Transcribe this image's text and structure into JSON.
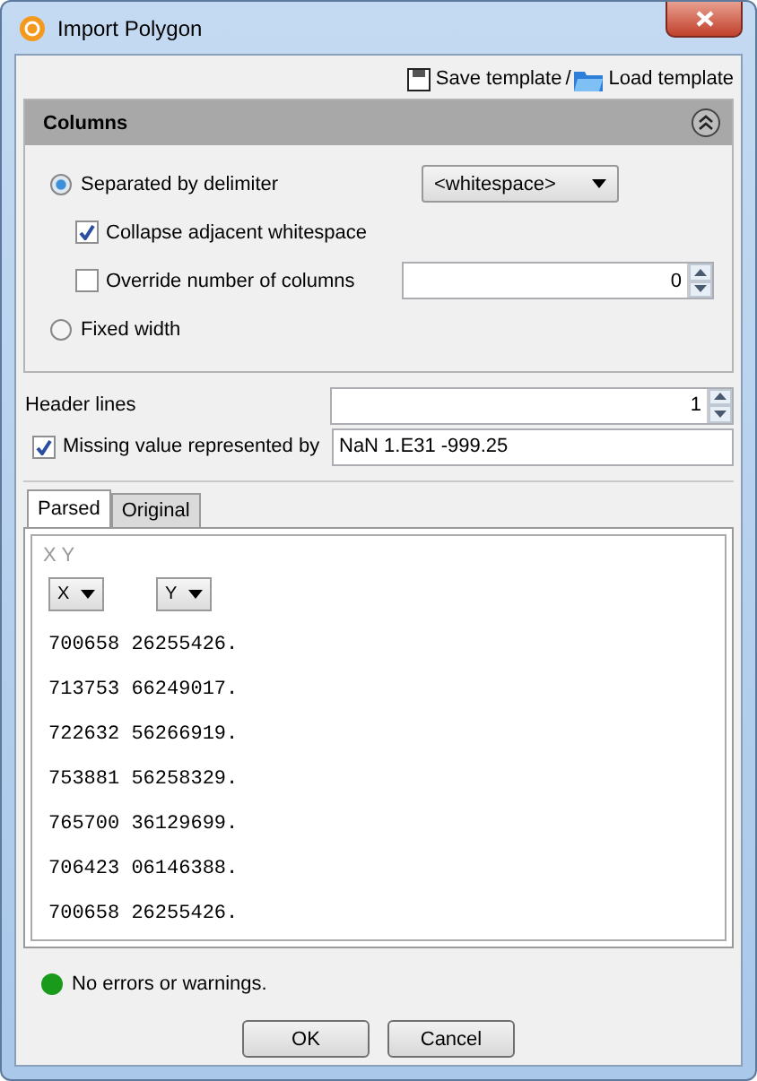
{
  "window": {
    "title": "Import Polygon"
  },
  "toolbar": {
    "save": "Save template",
    "separator": "/",
    "load": "Load template"
  },
  "columns_panel": {
    "title": "Columns",
    "expanded": true,
    "options": [
      {
        "kind": "radio",
        "label": "Separated by delimiter",
        "selected": true,
        "dropdown": "<whitespace>"
      },
      {
        "kind": "checkbox",
        "label": "Collapse adjacent whitespace",
        "checked": true
      },
      {
        "kind": "checkbox",
        "label": "Override number of columns",
        "checked": false,
        "value": "0"
      },
      {
        "kind": "radio",
        "label": "Fixed width",
        "selected": false
      }
    ]
  },
  "header_lines": {
    "label": "Header lines",
    "value": "1"
  },
  "missing_value": {
    "label": "Missing value represented by",
    "checked": true,
    "value": "NaN 1.E31 -999.25"
  },
  "tabs": [
    {
      "label": "Parsed",
      "selected": true
    },
    {
      "label": "Original",
      "selected": false
    }
  ],
  "preview": {
    "header": "X Y",
    "column_selectors": [
      "X",
      "Y"
    ],
    "rows": [
      "700658 26255426.",
      "713753 66249017.",
      "722632 56266919.",
      "753881 56258329.",
      "765700 36129699.",
      "706423 06146388.",
      "700658 26255426."
    ]
  },
  "status": {
    "color": "#1a9a1a",
    "message": "No errors or warnings."
  },
  "buttons": [
    "OK",
    "Cancel"
  ]
}
